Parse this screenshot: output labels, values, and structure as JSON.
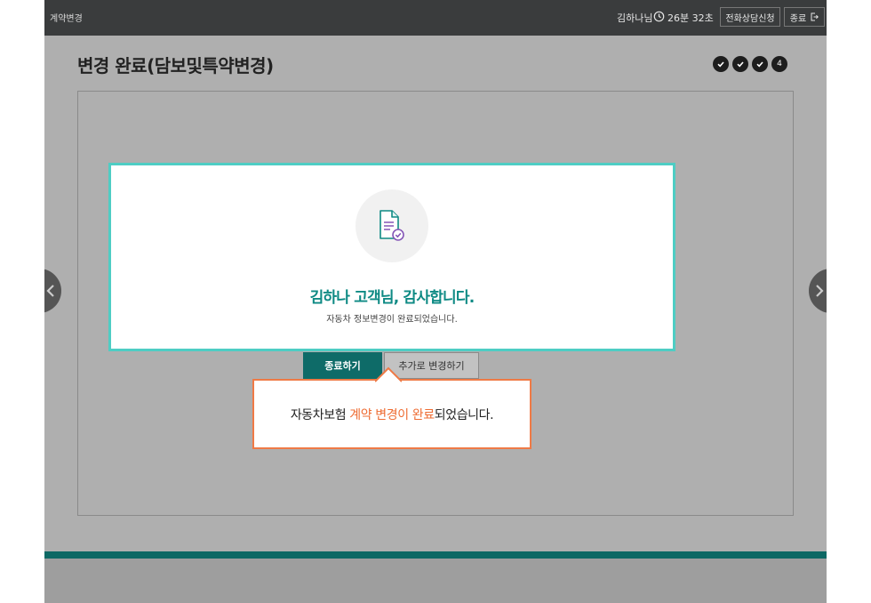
{
  "header": {
    "app_title": "계약변경",
    "user_name": "김하나님",
    "timer": "26분 32초",
    "consult_button": "전화상담신청",
    "end_button": "종료"
  },
  "page": {
    "title": "변경 완료(담보및특약변경)"
  },
  "steps": [
    {
      "state": "done",
      "label": ""
    },
    {
      "state": "done",
      "label": ""
    },
    {
      "state": "done",
      "label": ""
    },
    {
      "state": "current",
      "label": "4"
    }
  ],
  "modal": {
    "title": "김하나 고객님, 감사합니다.",
    "subtitle": "자동차 정보변경이 완료되었습니다."
  },
  "buttons": {
    "finish": "종료하기",
    "additional_change": "추가로 변경하기"
  },
  "tooltip": {
    "prefix": "자동차보험 ",
    "highlight": "계약 변경이 완료",
    "suffix": "되었습니다."
  },
  "colors": {
    "accent_teal": "#0e8a84",
    "primary_button": "#0e6b68",
    "modal_border": "#4ecdc4",
    "tooltip_highlight": "#ee6c33"
  },
  "icons": {
    "clock": "clock-icon",
    "exit": "exit-icon",
    "document": "document-check-icon",
    "check": "check-icon",
    "prev": "chevron-left-icon",
    "next": "chevron-right-icon"
  }
}
